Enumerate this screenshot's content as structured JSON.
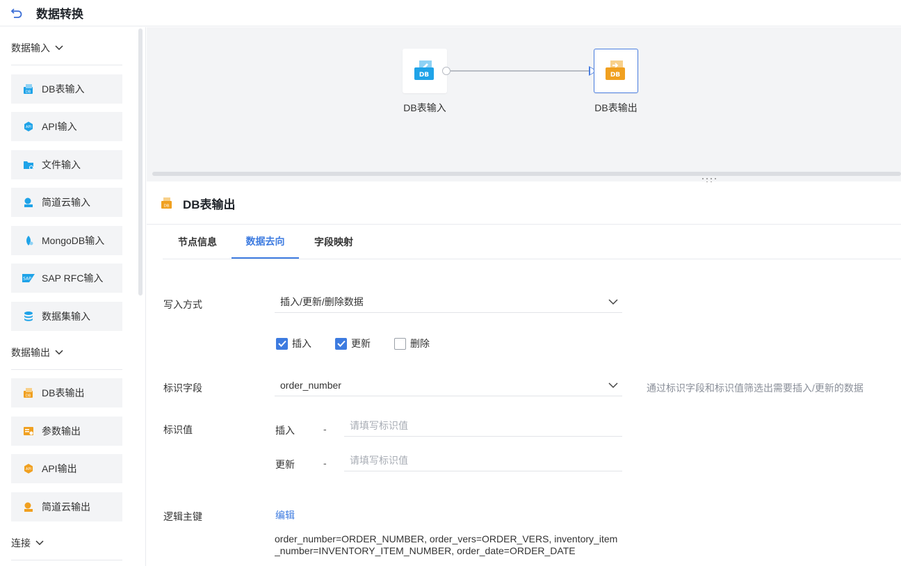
{
  "header": {
    "title": "数据转换"
  },
  "sidebar": {
    "groups": [
      {
        "title": "数据输入",
        "items": [
          {
            "label": "DB表输入",
            "icon": "db-input-icon"
          },
          {
            "label": "API输入",
            "icon": "api-input-icon"
          },
          {
            "label": "文件输入",
            "icon": "file-input-icon"
          },
          {
            "label": "简道云输入",
            "icon": "jdy-input-icon"
          },
          {
            "label": "MongoDB输入",
            "icon": "mongodb-input-icon"
          },
          {
            "label": "SAP RFC输入",
            "icon": "sap-input-icon"
          },
          {
            "label": "数据集输入",
            "icon": "dataset-input-icon"
          }
        ]
      },
      {
        "title": "数据输出",
        "items": [
          {
            "label": "DB表输出",
            "icon": "db-output-icon"
          },
          {
            "label": "参数输出",
            "icon": "param-output-icon"
          },
          {
            "label": "API输出",
            "icon": "api-output-icon"
          },
          {
            "label": "简道云输出",
            "icon": "jdy-output-icon"
          }
        ]
      },
      {
        "title": "连接",
        "items": []
      }
    ]
  },
  "canvas": {
    "nodes": [
      {
        "label": "DB表输入",
        "badge": "DB",
        "color": "#1fa3e8"
      },
      {
        "label": "DB表输出",
        "badge": "DB",
        "color": "#f0a020"
      }
    ]
  },
  "panel": {
    "title": "DB表输出",
    "tabs": [
      {
        "label": "节点信息"
      },
      {
        "label": "数据去向"
      },
      {
        "label": "字段映射"
      }
    ],
    "write_mode": {
      "label": "写入方式",
      "value": "插入/更新/删除数据"
    },
    "options": [
      {
        "label": "插入",
        "checked": true
      },
      {
        "label": "更新",
        "checked": true
      },
      {
        "label": "删除",
        "checked": false
      }
    ],
    "id_field": {
      "label": "标识字段",
      "value": "order_number",
      "hint": "通过标识字段和标识值筛选出需要插入/更新的数据"
    },
    "id_value": {
      "label": "标识值",
      "insert_label": "插入",
      "update_label": "更新",
      "dash": "-",
      "placeholder": "请填写标识值"
    },
    "logic_key": {
      "label": "逻辑主键",
      "edit_label": "编辑",
      "mapping": "order_number=ORDER_NUMBER, order_vers=ORDER_VERS, inventory_item_number=INVENTORY_ITEM_NUMBER, order_date=ORDER_DATE"
    }
  },
  "colors": {
    "accent": "#3d7be0",
    "input_node": "#1fa3e8",
    "output_node": "#f0a020"
  }
}
